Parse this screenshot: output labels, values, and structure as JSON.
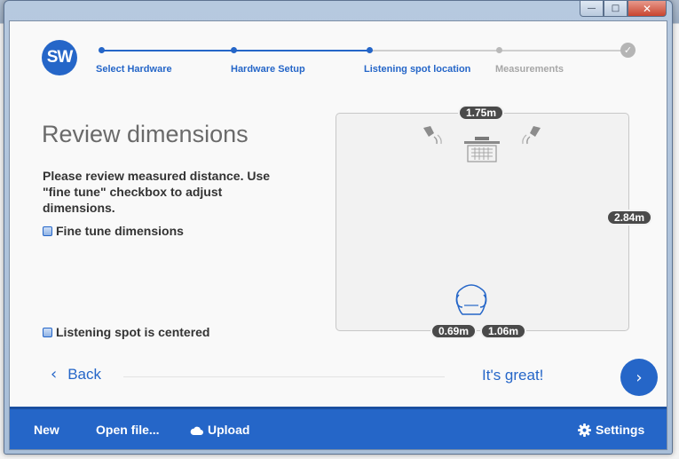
{
  "window": {
    "caption_buttons": {
      "minimize": "—",
      "maximize": "□",
      "close": "✕"
    }
  },
  "app": {
    "logo_text": "SW"
  },
  "stepper": {
    "steps": [
      {
        "label": "Select Hardware",
        "state": "done"
      },
      {
        "label": "Hardware Setup",
        "state": "done"
      },
      {
        "label": "Listening spot location",
        "state": "current"
      },
      {
        "label": "Measurements",
        "state": "todo"
      }
    ],
    "final_icon": "check-icon",
    "final_glyph": "✓"
  },
  "panel": {
    "title": "Review dimensions",
    "description": "Please review measured distance. Use \"fine tune\" checkbox to adjust dimensions.",
    "fine_tune_label": "Fine tune dimensions",
    "centered_label": "Listening spot is centered"
  },
  "room": {
    "width_label": "1.75m",
    "length_label": "2.84m",
    "spot_left_label": "0.69m",
    "spot_right_label": "1.06m"
  },
  "nav": {
    "back_label": "Back",
    "back_glyph": "‹",
    "confirm_label": "It's great!",
    "next_glyph": "›"
  },
  "footer": {
    "new_label": "New",
    "open_label": "Open file...",
    "upload_label": "Upload",
    "settings_label": "Settings"
  },
  "colors": {
    "accent": "#2566c8",
    "pill": "#4a4a4a"
  }
}
